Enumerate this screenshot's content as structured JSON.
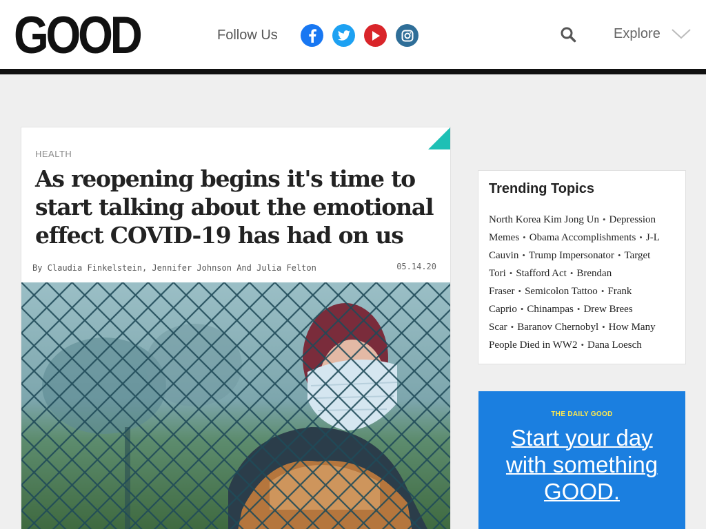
{
  "header": {
    "logo": "GOOD",
    "follow_label": "Follow Us",
    "social": [
      {
        "name": "facebook-icon",
        "color": "#1877f2"
      },
      {
        "name": "twitter-icon",
        "color": "#1da1f2"
      },
      {
        "name": "youtube-icon",
        "color": "#d9252a"
      },
      {
        "name": "instagram-icon",
        "color": "#2f6e98"
      }
    ],
    "search_icon": "search-icon",
    "explore_label": "Explore"
  },
  "article": {
    "category": "HEALTH",
    "title": "As reopening begins it's time to start talking about the emotional effect COVID-19 has had on us",
    "byline": "By Claudia Finkelstein, Jennifer Johnson And Julia Felton",
    "date": "05.14.20",
    "accent_color": "#1ec0b5"
  },
  "trending": {
    "title": "Trending Topics",
    "topics": [
      "North Korea Kim Jong Un",
      "Depression Memes",
      "Obama Accomplishments",
      "J-L Cauvin",
      "Trump Impersonator",
      "Target Tori",
      "Stafford Act",
      "Brendan Fraser",
      "Semicolon Tattoo",
      "Frank Caprio",
      "Chinampas",
      "Drew Brees Scar",
      "Baranov Chernobyl",
      "How Many People Died in WW2",
      "Dana Loesch"
    ]
  },
  "newsletter": {
    "label": "THE DAILY GOOD",
    "cta": "Start your day with something GOOD.",
    "bg_color": "#1b7fe0"
  }
}
